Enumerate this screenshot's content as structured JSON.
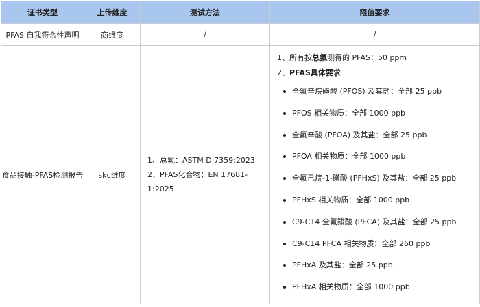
{
  "headers": [
    "证书类型",
    "上传维度",
    "测试方法",
    "限值要求"
  ],
  "rows": [
    {
      "type": "PFAS 自我符合性声明",
      "dimension": "商维度",
      "method": "/",
      "limit": "/"
    },
    {
      "type": "食品接触-PFAS检测报告",
      "dimension": "skc维度",
      "methods": [
        "1、总氟：ASTM D 7359:2023",
        "2、PFAS化合物：EN 17681-1:2025"
      ],
      "limits": {
        "line1_prefix": "1、所有按",
        "line1_bold": "总氟",
        "line1_suffix": "测得的 PFAS：50 ppm",
        "line2_prefix": "2、",
        "line2_bold": "PFAS具体要求",
        "items": [
          "全氟辛烷磺酸 (PFOS) 及其盐：全部 25 ppb",
          "PFOS 相关物质：全部 1000 ppb",
          "全氟辛酸 (PFOA) 及其盐：全部 25 ppb",
          "PFOA 相关物质：全部 1000 ppb",
          "全氟己烷-1-磺酸 (PFHxS) 及其盐：全部 25 ppb",
          "PFHxS 相关物质：全部 1000 ppb",
          "C9-C14 全氟羧酸 (PFCA) 及其盐：全部 25 ppb",
          "C9-C14 PFCA 相关物质：全部 260 ppb",
          "PFHxA 及其盐：全部 25 ppb",
          "PFHxA 相关物质：全部 1000 ppb"
        ]
      }
    }
  ],
  "colors": {
    "header_bg": "#a9c7ee",
    "border": "#c7ccd3"
  }
}
